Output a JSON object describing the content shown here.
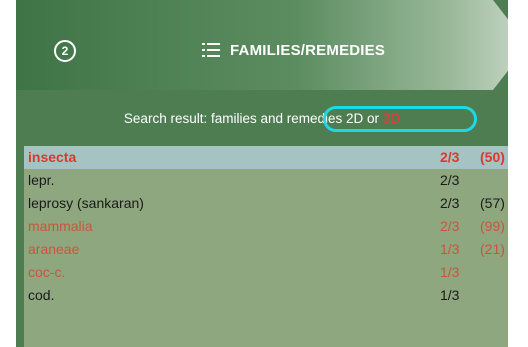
{
  "header": {
    "step": "2",
    "title": "FAMILIES/REMEDIES"
  },
  "search": {
    "prefix": "Search result: families and remedies 2D or ",
    "suffix_red": "3D"
  },
  "results": [
    {
      "name": "insecta",
      "fraction": "2/3",
      "count": "(50)",
      "style": "selected"
    },
    {
      "name": "lepr.",
      "fraction": "2/3",
      "count": "",
      "style": "normal"
    },
    {
      "name": "leprosy (sankaran)",
      "fraction": "2/3",
      "count": "(57)",
      "style": "normal"
    },
    {
      "name": "mammalia",
      "fraction": "2/3",
      "count": "(99)",
      "style": "red"
    },
    {
      "name": "araneae",
      "fraction": "1/3",
      "count": "(21)",
      "style": "red"
    },
    {
      "name": "coc-c.",
      "fraction": "1/3",
      "count": "",
      "style": "red"
    },
    {
      "name": "cod.",
      "fraction": "1/3",
      "count": "",
      "style": "normal"
    }
  ],
  "colors": {
    "panel": "#4f7d52",
    "list_bg": "#8ea77f",
    "selected_row": "#a6c3c4",
    "highlight_ring": "#1fd7e5",
    "red_text": "#c8563e"
  }
}
